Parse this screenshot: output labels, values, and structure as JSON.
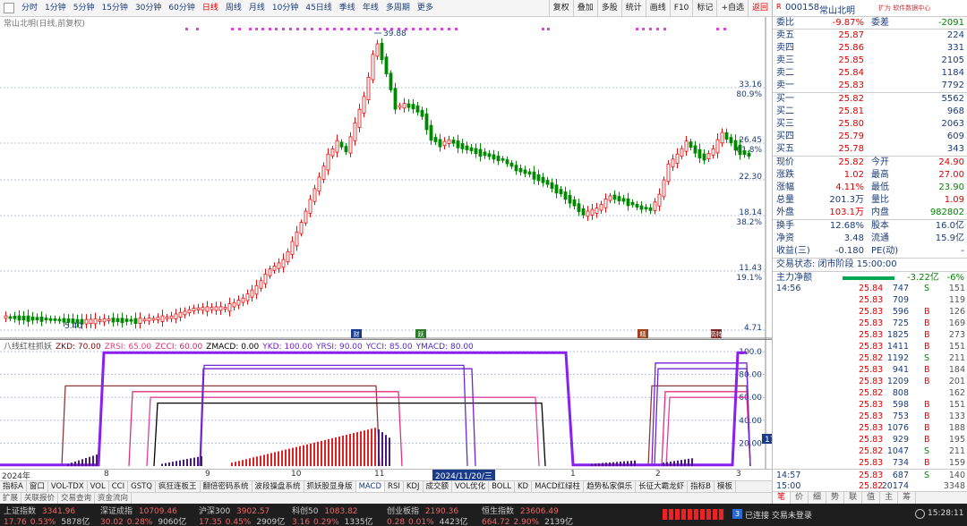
{
  "toolbar": {
    "periods": [
      "分时",
      "1分钟",
      "5分钟",
      "15分钟",
      "30分钟",
      "60分钟",
      "日线",
      "周线",
      "月线",
      "10分钟",
      "45日线",
      "季线",
      "年线",
      "多周期",
      "更多"
    ],
    "active_period": "日线",
    "tools": [
      "复权",
      "叠加",
      "多股",
      "统计",
      "画线",
      "F10",
      "标记",
      "+自选",
      "返回"
    ]
  },
  "stock": {
    "badge": "R",
    "code": "000158",
    "name": "常山北明",
    "info": "扩为 软件数据中心"
  },
  "chart": {
    "title": "常山北明(日线,前复权)",
    "y_labels": [
      {
        "price": "33.16",
        "pct": "80.9%"
      },
      {
        "price": "26.45",
        "pct": "61.8%"
      },
      {
        "price": "22.30",
        "pct": ""
      },
      {
        "price": "18.14",
        "pct": "38.2%"
      },
      {
        "price": "11.43",
        "pct": "19.1%"
      },
      {
        "price": "4.71",
        "pct": ""
      }
    ],
    "high_label": "39.88",
    "low_label": "5.40",
    "markers": [
      "财",
      "跃",
      "精",
      "高特"
    ]
  },
  "indicator": {
    "name": "八线红柱抓妖",
    "params": [
      {
        "text": "ZKD: 70.00",
        "color": "#8b0000"
      },
      {
        "text": "ZRSI: 65.00",
        "color": "#e0407a"
      },
      {
        "text": "ZCCI: 60.00",
        "color": "#d0206a"
      },
      {
        "text": "ZMACD: 0.00",
        "color": "#000000"
      },
      {
        "text": "YKD: 100.00",
        "color": "#7a1fd0"
      },
      {
        "text": "YRSI: 90.00",
        "color": "#6a2ad0"
      },
      {
        "text": "YCCI: 85.00",
        "color": "#5a2ad0"
      },
      {
        "text": "YMACD: 80.00",
        "color": "#4a2ad0"
      }
    ],
    "y_labels": [
      "100.0",
      "80.00",
      "60.00",
      "40.00",
      "20.00"
    ],
    "cursor_value": "17.97"
  },
  "dates": {
    "year": "2024年",
    "months": [
      "8",
      "9",
      "10",
      "11",
      "1",
      "2",
      "3"
    ],
    "selected": "2024/11/20/三",
    "tail": "日线"
  },
  "indicator_tabs": [
    "指标A",
    "窗口",
    "VOL-TDX",
    "VOL",
    "CCI",
    "GSTQ",
    "疯狂连板王",
    "翻倍密码系统",
    "波段操盘系统",
    "抓妖股显身版",
    "MACD",
    "RSI",
    "KDJ",
    "成交额",
    "VOL优化",
    "BOLL",
    "KD",
    "MACD红绿柱",
    "趋势私家俱乐",
    "长征大霸龙虾",
    "指标B",
    "模板"
  ],
  "func_tabs": [
    "扩展",
    "关联报价",
    "交易查询",
    "资金流向"
  ],
  "quote": {
    "ratio": {
      "label1": "委比",
      "val1": "-9.87%",
      "label2": "委差",
      "val2": "-2091"
    },
    "asks": [
      {
        "label": "卖五",
        "price": "25.87",
        "vol": "224"
      },
      {
        "label": "卖四",
        "price": "25.86",
        "vol": "331"
      },
      {
        "label": "卖三",
        "price": "25.85",
        "vol": "2105"
      },
      {
        "label": "卖二",
        "price": "25.84",
        "vol": "1184"
      },
      {
        "label": "卖一",
        "price": "25.83",
        "vol": "7792"
      }
    ],
    "bids": [
      {
        "label": "买一",
        "price": "25.82",
        "vol": "5562"
      },
      {
        "label": "买二",
        "price": "25.81",
        "vol": "968"
      },
      {
        "label": "买三",
        "price": "25.80",
        "vol": "2063"
      },
      {
        "label": "买四",
        "price": "25.79",
        "vol": "609"
      },
      {
        "label": "买五",
        "price": "25.78",
        "vol": "343"
      }
    ],
    "stats": [
      {
        "l1": "现价",
        "v1": "25.82",
        "l2": "今开",
        "v2": "24.90"
      },
      {
        "l1": "涨跌",
        "v1": "1.02",
        "l2": "最高",
        "v2": "27.00"
      },
      {
        "l1": "涨幅",
        "v1": "4.11%",
        "l2": "最低",
        "v2": "23.90"
      },
      {
        "l1": "总量",
        "v1": "201.3万",
        "l2": "量比",
        "v2": "1.09"
      },
      {
        "l1": "外盘",
        "v1": "103.1万",
        "l2": "内盘",
        "v2": "982802"
      }
    ],
    "stats2": [
      {
        "l1": "换手",
        "v1": "12.68%",
        "l2": "股本",
        "v2": "16.0亿"
      },
      {
        "l1": "净资",
        "v1": "3.48",
        "l2": "流通",
        "v2": "15.9亿"
      },
      {
        "l1": "收益(三)",
        "v1": "-0.180",
        "l2": "PE(动)",
        "v2": "-"
      }
    ],
    "trade_status": "交易状态: 闭市阶段 15:00:00",
    "net_flow": {
      "label": "主力净额",
      "value": "-3.22亿",
      "pct": "-6%"
    }
  },
  "ticks": [
    {
      "t": "14:56",
      "p": "25.84",
      "v": "747",
      "s": "S",
      "n": "151"
    },
    {
      "t": "",
      "p": "25.83",
      "v": "709",
      "s": "",
      "n": "119"
    },
    {
      "t": "",
      "p": "25.83",
      "v": "596",
      "s": "B",
      "n": "126"
    },
    {
      "t": "",
      "p": "25.83",
      "v": "725",
      "s": "B",
      "n": "169"
    },
    {
      "t": "",
      "p": "25.83",
      "v": "1825",
      "s": "B",
      "n": "273"
    },
    {
      "t": "",
      "p": "25.83",
      "v": "1411",
      "s": "B",
      "n": "151"
    },
    {
      "t": "",
      "p": "25.82",
      "v": "1192",
      "s": "S",
      "n": "211"
    },
    {
      "t": "",
      "p": "25.83",
      "v": "941",
      "s": "B",
      "n": "184"
    },
    {
      "t": "",
      "p": "25.83",
      "v": "1209",
      "s": "B",
      "n": "201"
    },
    {
      "t": "",
      "p": "25.82",
      "v": "808",
      "s": "",
      "n": "162"
    },
    {
      "t": "",
      "p": "25.83",
      "v": "598",
      "s": "B",
      "n": "151"
    },
    {
      "t": "",
      "p": "25.83",
      "v": "753",
      "s": "B",
      "n": "133"
    },
    {
      "t": "",
      "p": "25.83",
      "v": "1076",
      "s": "B",
      "n": "188"
    },
    {
      "t": "",
      "p": "25.83",
      "v": "929",
      "s": "B",
      "n": "195"
    },
    {
      "t": "",
      "p": "25.82",
      "v": "1047",
      "s": "S",
      "n": "211"
    },
    {
      "t": "",
      "p": "25.83",
      "v": "734",
      "s": "B",
      "n": "159"
    },
    {
      "t": "14:57",
      "p": "25.83",
      "v": "687",
      "s": "S",
      "n": "140"
    },
    {
      "t": "15:00",
      "p": "25.82",
      "v": "20174",
      "s": "",
      "n": "3348"
    }
  ],
  "right_tabs": [
    "笔",
    "价",
    "细",
    "势",
    "联",
    "值",
    "主",
    "筹"
  ],
  "right_bottom_label": "明细",
  "status": {
    "indices": [
      {
        "name": "上证指数",
        "val": "3341.96",
        "chg": "17.76",
        "pct": "0.53%",
        "amt": "5878亿"
      },
      {
        "name": "深证成指",
        "val": "10709.46",
        "chg": "30.02",
        "pct": "0.28%",
        "amt": "9060亿"
      },
      {
        "name": "沪深300",
        "val": "3902.57",
        "chg": "17.35",
        "pct": "0.45%",
        "amt": "2909亿"
      },
      {
        "name": "科创50",
        "val": "1083.82",
        "chg": "3.16",
        "pct": "0.29%",
        "amt": "1335亿"
      },
      {
        "name": "创业板指",
        "val": "2190.36",
        "chg": "0.28",
        "pct": "0.01%",
        "amt": "4423亿"
      },
      {
        "name": "恒生指数",
        "val": "23606.49",
        "chg": "664.72",
        "pct": "2.90%",
        "amt": "2139亿"
      }
    ],
    "connection": "已连接 交易未登录",
    "time": "15:28:11"
  }
}
